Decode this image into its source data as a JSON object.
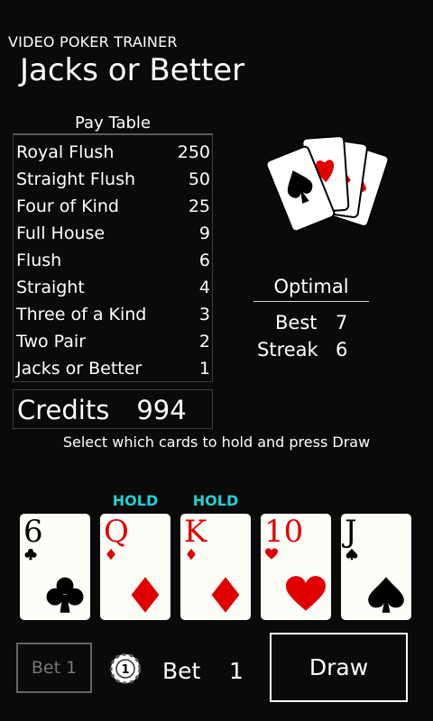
{
  "app": {
    "name": "VIDEO POKER TRAINER",
    "title": "Jacks or Better"
  },
  "paytable": {
    "title": "Pay Table",
    "rows": [
      {
        "hand": "Royal Flush",
        "payout": "250"
      },
      {
        "hand": "Straight Flush",
        "payout": "50"
      },
      {
        "hand": "Four of Kind",
        "payout": "25"
      },
      {
        "hand": "Full House",
        "payout": "9"
      },
      {
        "hand": "Flush",
        "payout": "6"
      },
      {
        "hand": "Straight",
        "payout": "4"
      },
      {
        "hand": "Three of a Kind",
        "payout": "3"
      },
      {
        "hand": "Two Pair",
        "payout": "2"
      },
      {
        "hand": "Jacks or Better",
        "payout": "1"
      }
    ]
  },
  "credits": {
    "label": "Credits",
    "value": "994"
  },
  "optimal": {
    "title": "Optimal",
    "best_label": "Best",
    "best_value": "7",
    "streak_label": "Streak",
    "streak_value": "6"
  },
  "instruction": "Select which cards to hold and press Draw",
  "hand": [
    {
      "rank": "6",
      "suit": "club-icon",
      "color": "black",
      "held": false,
      "hold_label": ""
    },
    {
      "rank": "Q",
      "suit": "diamond-icon",
      "color": "red",
      "held": true,
      "hold_label": "HOLD"
    },
    {
      "rank": "K",
      "suit": "diamond-icon",
      "color": "red",
      "held": true,
      "hold_label": "HOLD"
    },
    {
      "rank": "10",
      "suit": "heart-icon",
      "color": "red",
      "held": false,
      "hold_label": ""
    },
    {
      "rank": "J",
      "suit": "spade-icon",
      "color": "black",
      "held": false,
      "hold_label": ""
    }
  ],
  "controls": {
    "bet_one_label": "Bet 1",
    "chip_value": "1",
    "bet_label": "Bet",
    "bet_value": "1",
    "draw_label": "Draw"
  },
  "colors": {
    "background": "#0a0a0a",
    "hold": "#1fd2d2",
    "red_suit": "#e10000"
  }
}
